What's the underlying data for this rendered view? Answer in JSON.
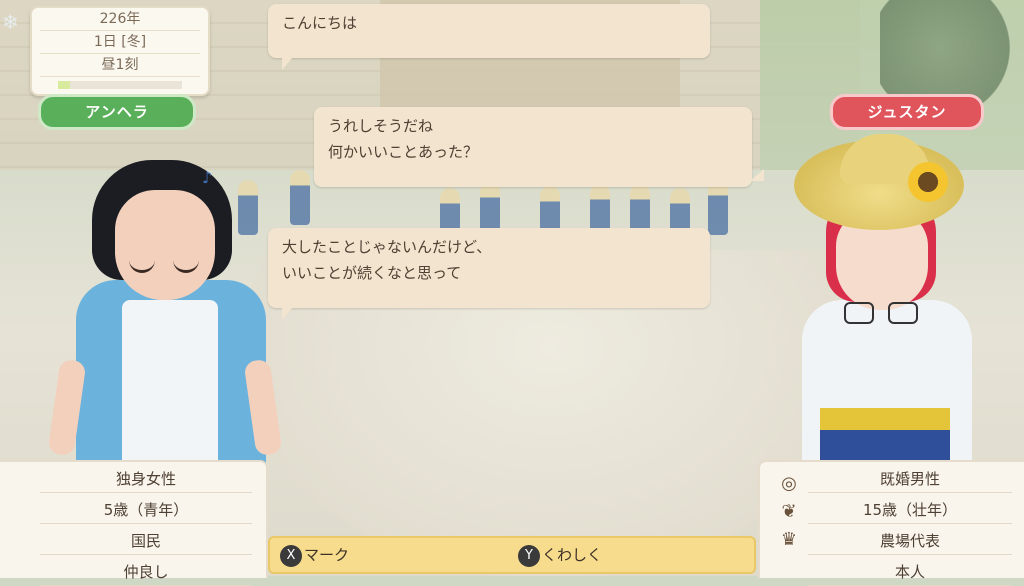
{
  "calendar": {
    "year": "226年",
    "day": "1日 [冬]",
    "time": "昼1刻",
    "day_progress": 0.1
  },
  "characters": {
    "left": {
      "name": "アンヘラ",
      "info": [
        "独身女性",
        "5歳（青年）",
        "国民",
        "仲良し"
      ]
    },
    "right": {
      "name": "ジュスタン",
      "info": [
        "既婚男性",
        "15歳（壮年）",
        "農場代表",
        "本人"
      ],
      "icons": [
        "ring-icon",
        "wheat-icon",
        "crown-icon"
      ]
    }
  },
  "dialogue": {
    "line1": "こんにちは",
    "line2a": "うれしそうだね",
    "line2b": "何かいいことあった？",
    "line3a": "大したことじゃないんだけど、",
    "line3b": "いいことが続くなと思って"
  },
  "controls": {
    "x_key": "X",
    "x_label": "マーク",
    "y_key": "Y",
    "y_label": "くわしく"
  },
  "colors": {
    "left_tag": "#5ab05a",
    "right_tag": "#e0545c",
    "bubble": "#f2e4ce",
    "button_bar": "#f6dc8c"
  }
}
